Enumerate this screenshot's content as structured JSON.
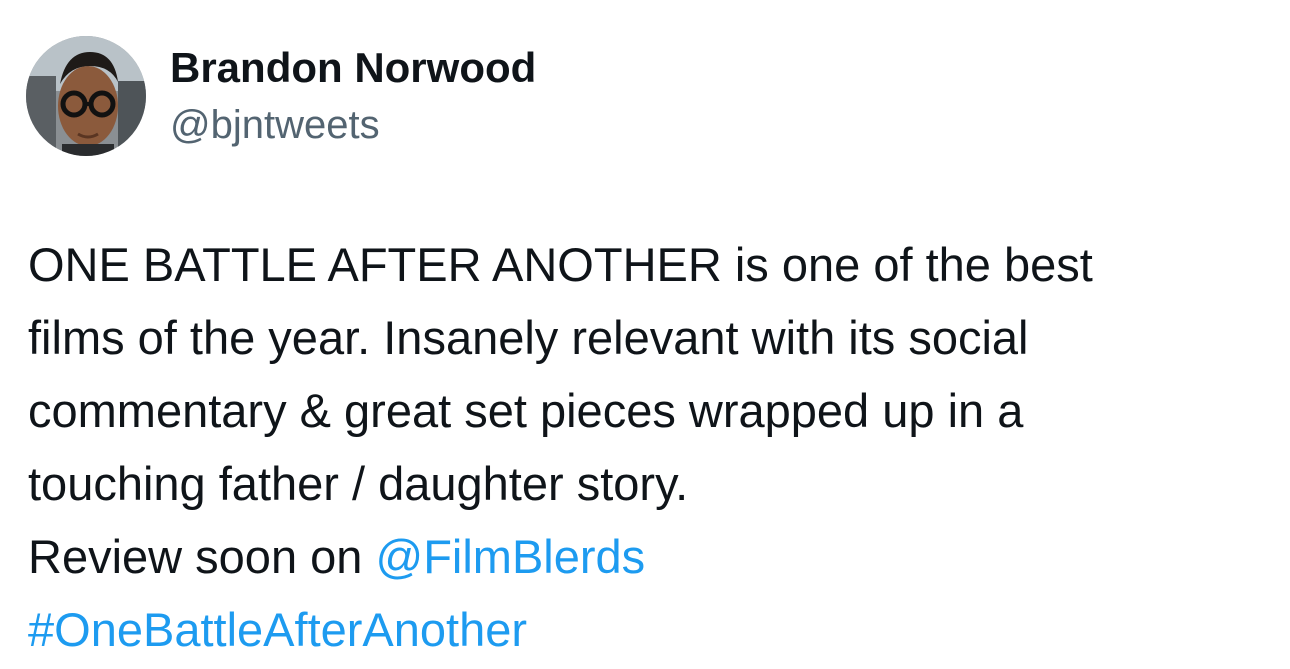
{
  "author": {
    "display_name": "Brandon Norwood",
    "handle": "@bjntweets",
    "avatar_icon": "profile-photo"
  },
  "tweet": {
    "lines": [
      "ONE BATTLE AFTER ANOTHER is one of the best",
      "films of the year. Insanely relevant with its social",
      "commentary & great set pieces wrapped up in a",
      "touching father / daughter story."
    ],
    "review_prefix": "Review soon on ",
    "mention": "@FilmBlerds",
    "hashtag": "#OneBattleAfterAnother"
  },
  "colors": {
    "text": "#0f1419",
    "secondary": "#536471",
    "link": "#1d9bf0"
  }
}
